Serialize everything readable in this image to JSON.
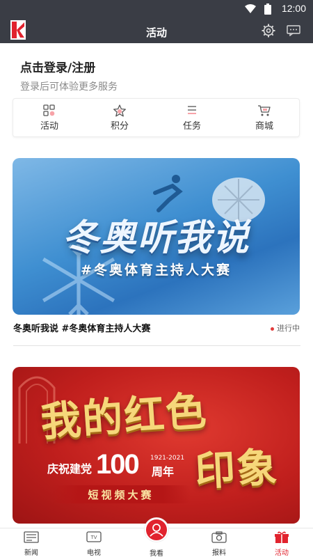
{
  "status_bar": {
    "time": "12:00",
    "icons": [
      "wifi-icon",
      "battery-icon"
    ]
  },
  "app_bar": {
    "title": "活动",
    "icons": [
      "app-logo",
      "gear-icon",
      "message-icon"
    ]
  },
  "login": {
    "title": "点击登录/注册",
    "subtitle": "登录后可体验更多服务"
  },
  "quick_actions": [
    {
      "label": "活动",
      "icon": "grid-icon"
    },
    {
      "label": "积分",
      "icon": "star-icon"
    },
    {
      "label": "任务",
      "icon": "list-icon"
    },
    {
      "label": "商城",
      "icon": "cart-icon"
    }
  ],
  "activities": [
    {
      "banner_title": "冬奥听我说",
      "banner_subtitle": "#冬奥体育主持人大赛",
      "caption": "冬奥听我说 #冬奥体育主持人大赛",
      "status": "进行中"
    },
    {
      "banner_title_line1": "我的红色",
      "banner_title_line2": "印象",
      "party_text": "庆祝建党",
      "number": "100",
      "years": "1921-2021",
      "anniversary": "周年",
      "contest": "短视频大赛"
    }
  ],
  "tab_bar": {
    "tabs": [
      {
        "label": "新闻",
        "icon": "news-icon"
      },
      {
        "label": "电视",
        "icon": "tv-icon"
      },
      {
        "label": "我看",
        "icon": "watch-icon"
      },
      {
        "label": "报料",
        "icon": "camera-icon"
      },
      {
        "label": "活动",
        "icon": "gift-icon"
      }
    ],
    "active": "活动"
  },
  "colors": {
    "app_bar": "#3a3d45",
    "accent": "#e1232e",
    "status_dot": "#e23b3b"
  }
}
